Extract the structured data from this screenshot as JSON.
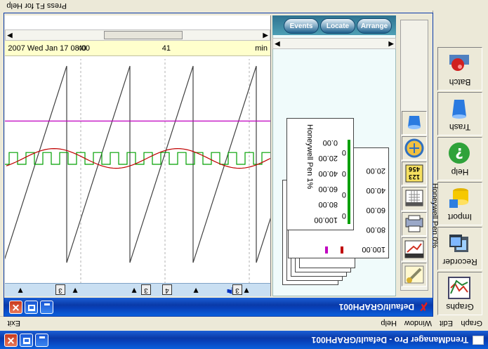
{
  "app": {
    "title": "TrendManager Pro - Default/GRAPH001",
    "menu": [
      "Graph",
      "Edit",
      "Window",
      "Help"
    ],
    "exit_label": "Exit",
    "status_text": "Press F1 for Help"
  },
  "sidebar": {
    "items": [
      {
        "label": "Graphs",
        "icon": "graph-icon"
      },
      {
        "label": "Recorder",
        "icon": "recorder-icon"
      },
      {
        "label": "Import",
        "icon": "database-icon"
      },
      {
        "label": "Help",
        "icon": "help-icon"
      },
      {
        "label": "Trash",
        "icon": "trash-icon"
      },
      {
        "label": "Batch",
        "icon": "batch-icon"
      }
    ]
  },
  "doc_window": {
    "title": "Default/GRAPH001"
  },
  "toolbar": {
    "icons": [
      "wrench-icon",
      "chart-icon",
      "printer-icon",
      "calendar-icon",
      "digital-display-icon",
      "compass-icon",
      "eraser-icon"
    ],
    "digital_text": "456\n123"
  },
  "tabs": [
    "Events",
    "Locate",
    "Arrange"
  ],
  "chart": {
    "date_label": "2007 Wed Jan 17 08:00",
    "time_ticks": [
      "40",
      "41"
    ],
    "unit_label": "min",
    "event_markers": [
      "3",
      "3",
      "4",
      "3",
      "3"
    ]
  },
  "pens": {
    "cards": [
      {
        "title": "Honeywell Pen 1%",
        "scale": [
          "100.00",
          "80.00",
          "60.00",
          "40.00",
          "20.00",
          "0.00"
        ],
        "color": "#00a000"
      },
      {
        "title": "Honeywell Pen 0%",
        "scale": [
          "100.00",
          "80.00",
          "60.00",
          "40.00",
          "20.00",
          "0.00"
        ],
        "color": "#ff00ff"
      }
    ],
    "digit": "0"
  },
  "colors": {
    "title_blue": "#0a3aa8",
    "plot_bg": "#ffffff",
    "axis_bg": "#ffffcc",
    "pen_green": "#00a000",
    "pen_magenta": "#c000c0",
    "pen_red": "#c00000",
    "pen_gray": "#404040"
  },
  "chart_data": {
    "type": "line",
    "title": "",
    "x_ticks": [
      "40",
      "41"
    ],
    "x_unit": "min",
    "series": [
      {
        "color": "#404040",
        "shape": "sawtooth",
        "min": 0,
        "max": 100
      },
      {
        "color": "#00a000",
        "shape": "square",
        "min": 44,
        "max": 50
      },
      {
        "color": "#c00000",
        "shape": "sine",
        "min": 42,
        "max": 52
      },
      {
        "color": "#c000c0",
        "shape": "flat",
        "value": 28
      }
    ]
  }
}
